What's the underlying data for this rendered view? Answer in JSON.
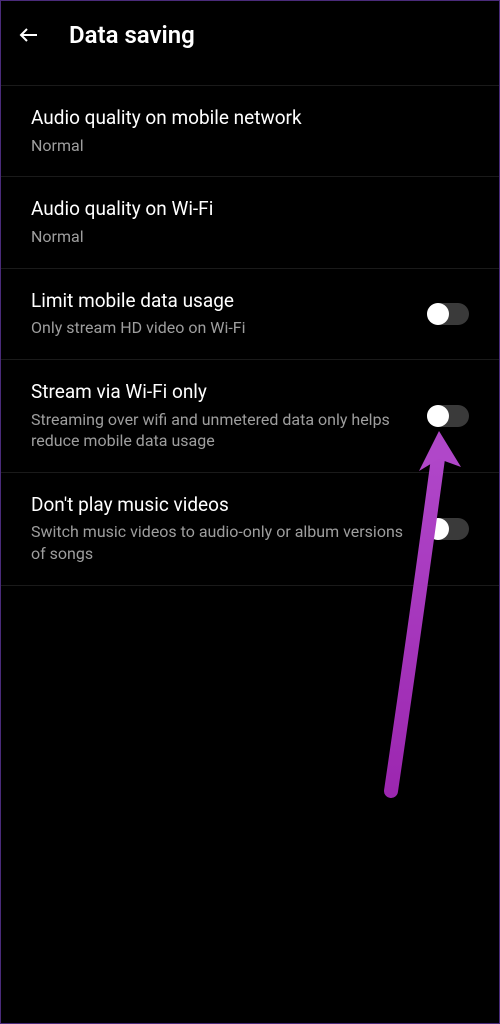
{
  "header": {
    "title": "Data saving"
  },
  "settings": [
    {
      "title": "Audio quality on mobile network",
      "subtitle": "Normal",
      "hasToggle": false
    },
    {
      "title": "Audio quality on Wi-Fi",
      "subtitle": "Normal",
      "hasToggle": false
    },
    {
      "title": "Limit mobile data usage",
      "subtitle": "Only stream HD video on Wi-Fi",
      "hasToggle": true,
      "toggleState": false
    },
    {
      "title": "Stream via Wi-Fi only",
      "subtitle": "Streaming over wifi and unmetered data only helps reduce mobile data usage",
      "hasToggle": true,
      "toggleState": false
    },
    {
      "title": "Don't play music videos",
      "subtitle": "Switch music videos to audio-only or album versions of songs",
      "hasToggle": true,
      "toggleState": false
    }
  ],
  "annotation": {
    "arrowColor": "#9c27b0"
  }
}
